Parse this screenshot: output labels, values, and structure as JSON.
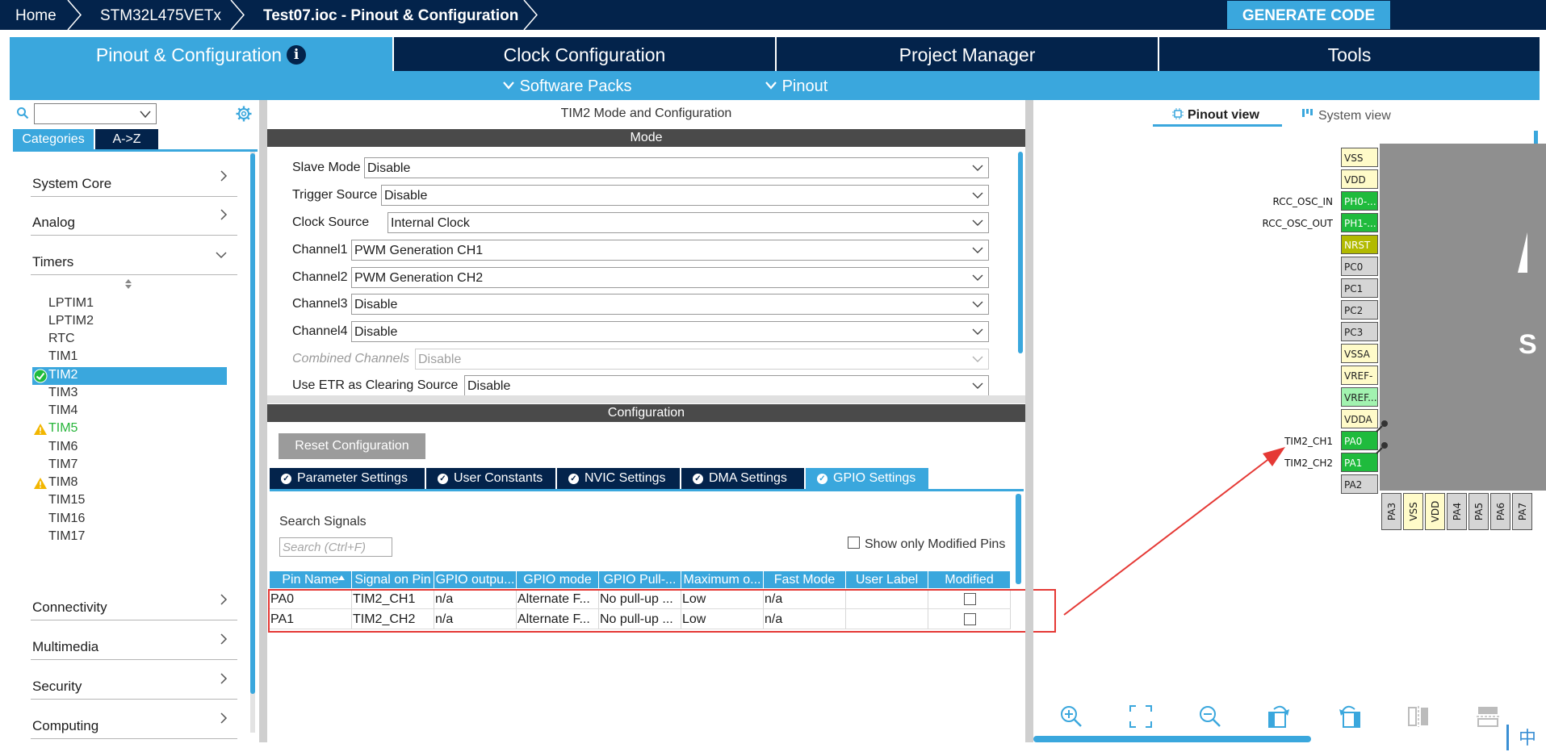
{
  "breadcrumb": {
    "home": "Home",
    "mcu": "STM32L475VETx",
    "file": "Test07.ioc - Pinout & Configuration"
  },
  "generate_label": "GENERATE CODE",
  "main_tabs": {
    "pinout": "Pinout & Configuration",
    "clock": "Clock Configuration",
    "project": "Project Manager",
    "tools": "Tools",
    "info_glyph": "i"
  },
  "subbar": {
    "software_packs": "Software Packs",
    "pinout": "Pinout"
  },
  "left": {
    "category_tab": "Categories",
    "az_tab": "A->Z",
    "categories": {
      "system_core": "System Core",
      "analog": "Analog",
      "timers": "Timers",
      "connectivity": "Connectivity",
      "multimedia": "Multimedia",
      "security": "Security",
      "computing": "Computing"
    },
    "timers": [
      "LPTIM1",
      "LPTIM2",
      "RTC",
      "TIM1",
      "TIM2",
      "TIM3",
      "TIM4",
      "TIM5",
      "TIM6",
      "TIM7",
      "TIM8",
      "TIM15",
      "TIM16",
      "TIM17"
    ],
    "selected_timer": "TIM2",
    "warning_timers": [
      "TIM5",
      "TIM8"
    ]
  },
  "mid": {
    "title": "TIM2 Mode and Configuration",
    "mode_header": "Mode",
    "mode": {
      "slave_label": "Slave Mode",
      "slave_value": "Disable",
      "trigger_label": "Trigger Source",
      "trigger_value": "Disable",
      "clock_label": "Clock Source",
      "clock_value": "Internal Clock",
      "ch1_label": "Channel1",
      "ch1_value": "PWM Generation CH1",
      "ch2_label": "Channel2",
      "ch2_value": "PWM Generation CH2",
      "ch3_label": "Channel3",
      "ch3_value": "Disable",
      "ch4_label": "Channel4",
      "ch4_value": "Disable",
      "combined_label": "Combined Channels",
      "combined_value": "Disable",
      "etr_label": "Use ETR as Clearing Source",
      "etr_value": "Disable"
    },
    "config_header": "Configuration",
    "reset_label": "Reset Configuration",
    "subtabs": {
      "params": "Parameter Settings",
      "user": "User Constants",
      "nvic": "NVIC Settings",
      "dma": "DMA Settings",
      "gpio": "GPIO Settings"
    },
    "search_label": "Search Signals",
    "search_placeholder": "Search (Ctrl+F)",
    "modified_only": "Show only Modified Pins",
    "table": {
      "headers": [
        "Pin Name",
        "Signal on Pin",
        "GPIO outpu...",
        "GPIO mode",
        "GPIO Pull-...",
        "Maximum o...",
        "Fast Mode",
        "User Label",
        "Modified"
      ],
      "rows": [
        [
          "PA0",
          "TIM2_CH1",
          "n/a",
          "Alternate F...",
          "No pull-up ...",
          "Low",
          "n/a",
          "",
          ""
        ],
        [
          "PA1",
          "TIM2_CH2",
          "n/a",
          "Alternate F...",
          "No pull-up ...",
          "Low",
          "n/a",
          "",
          ""
        ]
      ]
    }
  },
  "right": {
    "pinout_view": "Pinout view",
    "system_view": "System view",
    "pins": [
      "VSS",
      "VDD",
      "PH0-...",
      "PH1-...",
      "NRST",
      "PC0",
      "PC1",
      "PC2",
      "PC3",
      "VSSA",
      "VREF-",
      "VREF...",
      "VDDA",
      "PA0",
      "PA1",
      "PA2"
    ],
    "pin_labels": {
      "ph0": "RCC_OSC_IN",
      "ph1": "RCC_OSC_OUT",
      "pa0": "TIM2_CH1",
      "pa1": "TIM2_CH2"
    },
    "bottom_pins": [
      "PA3",
      "VSS",
      "VDD",
      "PA4",
      "PA5",
      "PA6",
      "PA7"
    ],
    "chip_letter": "S"
  },
  "ime": "中",
  "colors": {
    "navy": "#03234b",
    "accent": "#3aa7dd",
    "pin_green": "#1fbb3d",
    "pin_yellow": "#fffbc9",
    "annotation_red": "#e53935"
  }
}
